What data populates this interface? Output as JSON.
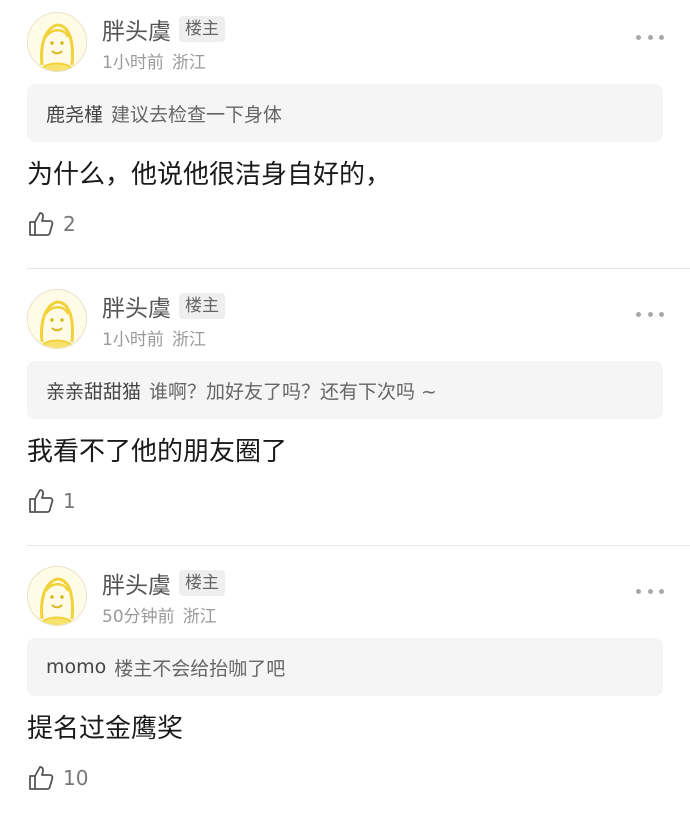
{
  "colors": {
    "avatar_accent": "#f2d23a",
    "divider": "#e6e6e6",
    "quote_bg": "#f5f5f5"
  },
  "comments": [
    {
      "author": "胖头虞",
      "badge": "楼主",
      "time": "1小时前",
      "location": "浙江",
      "quote_name": "鹿尧槿",
      "quote_text": "建议去检查一下身体",
      "body": "为什么，他说他很洁身自好的，",
      "likes": "2"
    },
    {
      "author": "胖头虞",
      "badge": "楼主",
      "time": "1小时前",
      "location": "浙江",
      "quote_name": "亲亲甜甜猫",
      "quote_text": "谁啊？加好友了吗？还有下次吗 ~",
      "body": "我看不了他的朋友圈了",
      "likes": "1"
    },
    {
      "author": "胖头虞",
      "badge": "楼主",
      "time": "50分钟前",
      "location": "浙江",
      "quote_name": "momo",
      "quote_text": "楼主不会给抬咖了吧",
      "body": "提名过金鹰奖",
      "likes": "10"
    }
  ]
}
